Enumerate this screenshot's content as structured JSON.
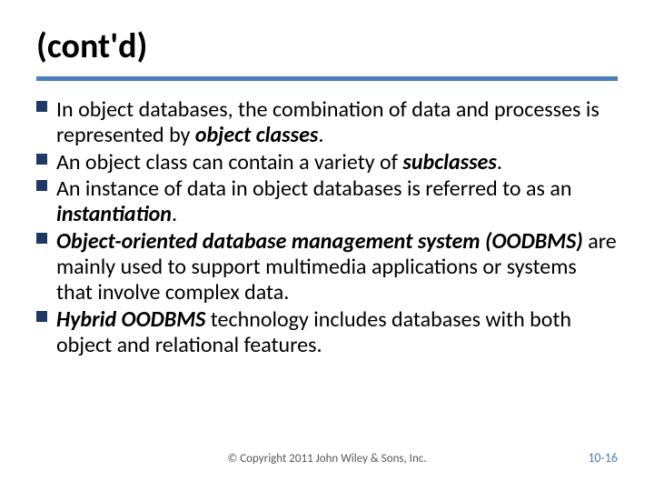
{
  "title": "(cont'd)",
  "bullets": [
    {
      "pre": "In object databases, the combination of data and processes is represented by ",
      "bold": "object classes",
      "post": "."
    },
    {
      "pre": "An object class can contain a variety of ",
      "bold": "subclasses",
      "post": "."
    },
    {
      "pre": "An instance of data in object databases is referred to as an ",
      "bold": "instantiation",
      "post": "."
    },
    {
      "pre": "",
      "bold": "Object-oriented database management system (OODBMS)",
      "post": " are mainly used to support multimedia applications or systems that involve complex data."
    },
    {
      "pre": "",
      "bold": "Hybrid OODBMS",
      "post": " technology includes databases with both object and relational features."
    }
  ],
  "footer": "© Copyright 2011 John Wiley & Sons, Inc.",
  "pagenum": "10-16"
}
